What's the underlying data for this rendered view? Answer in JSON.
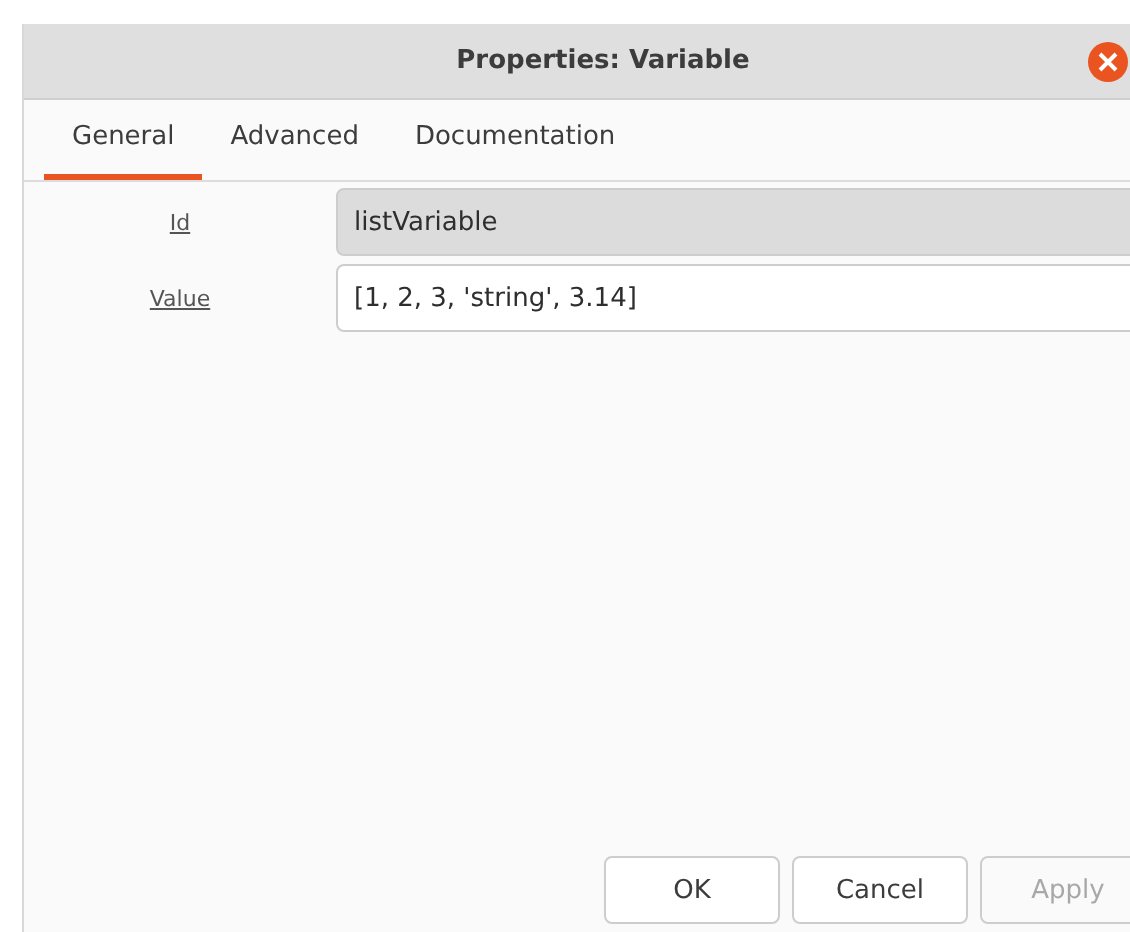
{
  "window": {
    "title": "Properties: Variable"
  },
  "tabs": [
    {
      "label": "General",
      "selected": true
    },
    {
      "label": "Advanced",
      "selected": false
    },
    {
      "label": "Documentation",
      "selected": false
    }
  ],
  "fields": [
    {
      "label": "Id",
      "value": "listVariable",
      "readonly": true
    },
    {
      "label": "Value",
      "value": "[1, 2, 3, 'string', 3.14]",
      "readonly": false
    }
  ],
  "buttons": [
    {
      "label": "OK",
      "disabled": false
    },
    {
      "label": "Cancel",
      "disabled": false
    },
    {
      "label": "Apply",
      "disabled": true
    }
  ]
}
